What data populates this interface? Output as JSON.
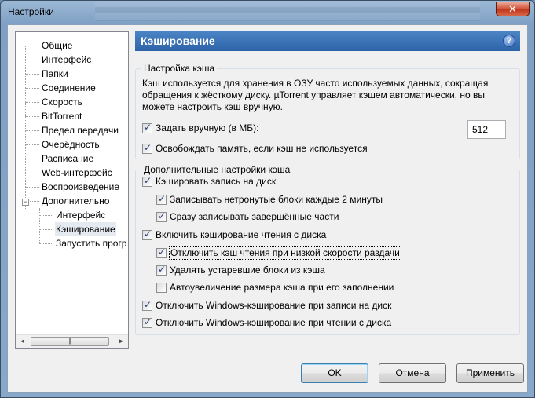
{
  "window": {
    "title": "Настройки",
    "close_glyph": "✕"
  },
  "tree": {
    "items": [
      {
        "label": "Общие",
        "level": 0
      },
      {
        "label": "Интерфейс",
        "level": 0
      },
      {
        "label": "Папки",
        "level": 0
      },
      {
        "label": "Соединение",
        "level": 0
      },
      {
        "label": "Скорость",
        "level": 0
      },
      {
        "label": "BitTorrent",
        "level": 0
      },
      {
        "label": "Предел передачи",
        "level": 0
      },
      {
        "label": "Очерёдность",
        "level": 0
      },
      {
        "label": "Расписание",
        "level": 0
      },
      {
        "label": "Web-интерфейс",
        "level": 0
      },
      {
        "label": "Воспроизведение",
        "level": 0
      },
      {
        "label": "Дополнительно",
        "level": 0
      },
      {
        "label": "Интерфейс",
        "level": 1
      },
      {
        "label": "Кэширование",
        "level": 1
      },
      {
        "label": "Запустить прогр",
        "level": 1
      }
    ],
    "expander_glyph": "−",
    "scroll_left": "◄",
    "scroll_right": "►",
    "scroll_grip": "|||"
  },
  "header": {
    "title": "Кэширование",
    "help_glyph": "?"
  },
  "cache_settings": {
    "title": "Настройка кэша",
    "description_lines": [
      "Кэш используется для хранения в ОЗУ часто используемых данных, сокращая",
      "обращения к жёсткому диску. µTorrent управляет кэшем автоматически, но вы",
      "можете настроить кэш вручную."
    ],
    "manual_label": "Задать вручную (в МБ):",
    "manual_checked": true,
    "manual_value": "512",
    "free_memory_label": "Освобождать память, если кэш не используется",
    "free_memory_checked": true
  },
  "advanced": {
    "title": "Дополнительные настройки кэша",
    "options": [
      {
        "label": "Кэшировать запись на диск",
        "checked": true,
        "indent": 0
      },
      {
        "label": "Записывать нетронутые блоки каждые 2 минуты",
        "checked": true,
        "indent": 1
      },
      {
        "label": "Сразу записывать завершённые части",
        "checked": true,
        "indent": 1
      },
      {
        "label": "Включить кэширование чтения с диска",
        "checked": true,
        "indent": 0
      },
      {
        "label": "Отключить кэш чтения при низкой скорости раздачи",
        "checked": true,
        "indent": 1
      },
      {
        "label": "Удалять устаревшие блоки из кэша",
        "checked": true,
        "indent": 1
      },
      {
        "label": "Автоувеличение размера кэша при его заполнении",
        "checked": false,
        "indent": 1
      },
      {
        "label": "Отключить Windows-кэширование при записи на диск",
        "checked": true,
        "indent": 0
      },
      {
        "label": "Отключить Windows-кэширование при чтении с диска",
        "checked": true,
        "indent": 0
      }
    ]
  },
  "buttons": {
    "ok": "OK",
    "cancel": "Отмена",
    "apply": "Применить"
  }
}
